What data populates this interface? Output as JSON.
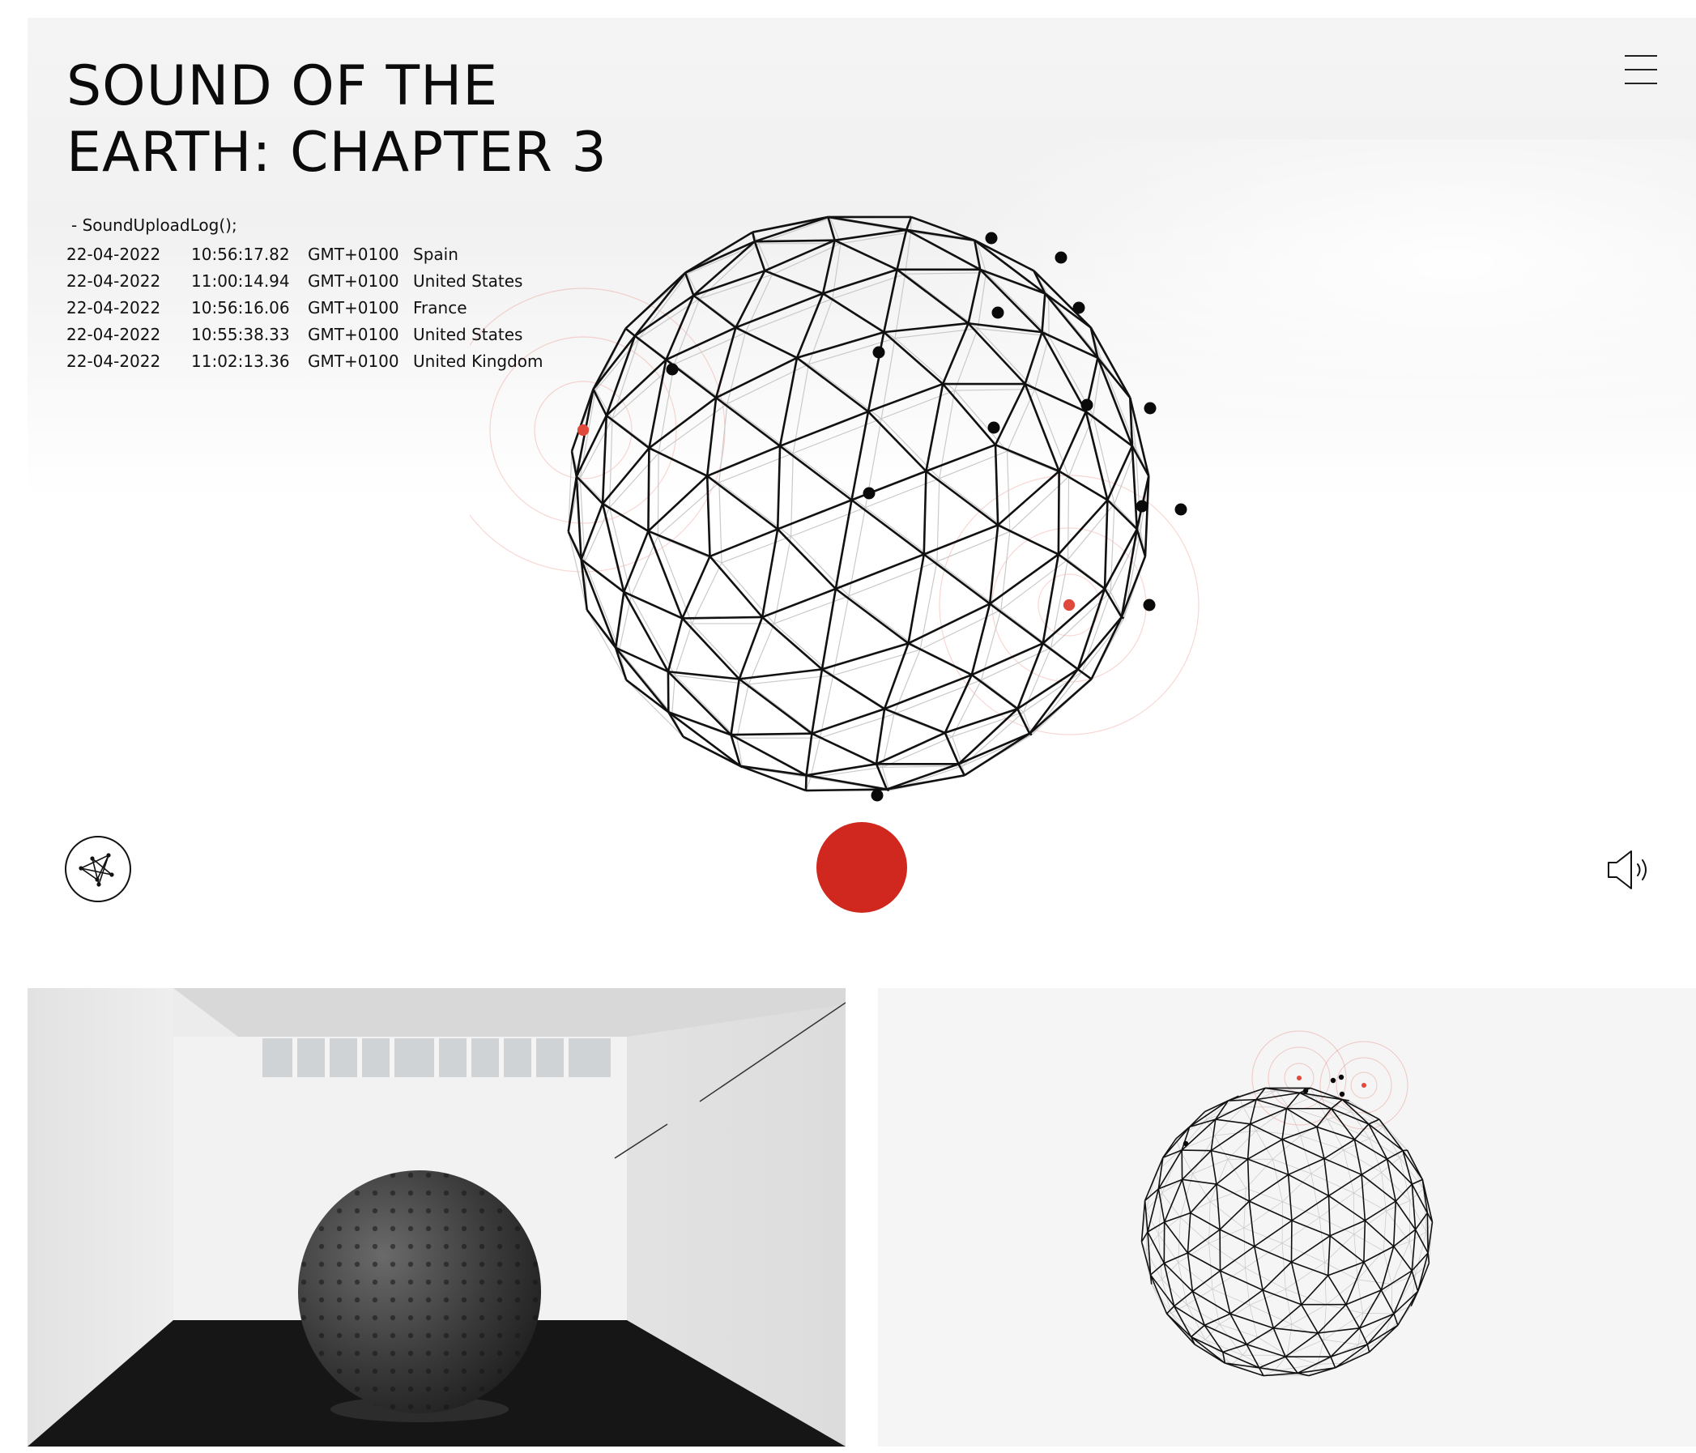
{
  "header": {
    "title_line1": "SOUND OF THE",
    "title_line2": "EARTH: CHAPTER 3"
  },
  "menu": {
    "icon": "hamburger-icon"
  },
  "log": {
    "heading": "-  SoundUploadLog();",
    "entries": [
      {
        "date": "22-04-2022",
        "time": "10:56:17.82",
        "tz": "GMT+0100",
        "country": "Spain"
      },
      {
        "date": "22-04-2022",
        "time": "11:00:14.94",
        "tz": "GMT+0100",
        "country": "United States"
      },
      {
        "date": "22-04-2022",
        "time": "10:56:16.06",
        "tz": "GMT+0100",
        "country": "France"
      },
      {
        "date": "22-04-2022",
        "time": "10:55:38.33",
        "tz": "GMT+0100",
        "country": "United States"
      },
      {
        "date": "22-04-2022",
        "time": "11:02:13.36",
        "tz": "GMT+0100",
        "country": "United Kingdom"
      }
    ]
  },
  "controls": {
    "left_icon": "network-graph-icon",
    "center_icon": "record-icon",
    "right_icon": "speaker-icon"
  },
  "colors": {
    "accent_red": "#d0281f",
    "marker_red": "#e04a3c",
    "wire_dark": "#111111",
    "wire_light": "#c9c9c9"
  }
}
